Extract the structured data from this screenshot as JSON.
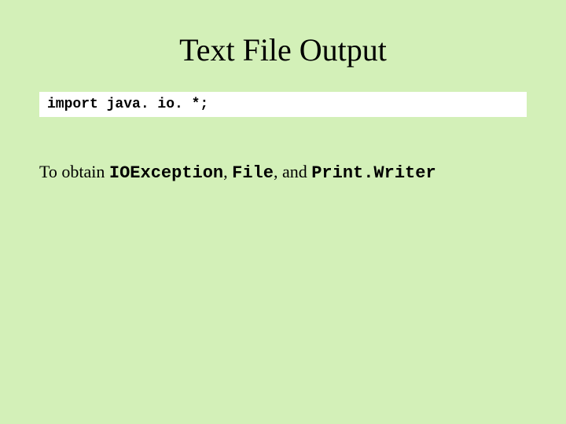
{
  "title": "Text File Output",
  "code_line": "import java. io. *;",
  "description": {
    "prefix": "To obtain ",
    "class1": "IOException",
    "sep1": ", ",
    "class2": "File",
    "sep2": ", and ",
    "class3": "Print.Writer"
  }
}
